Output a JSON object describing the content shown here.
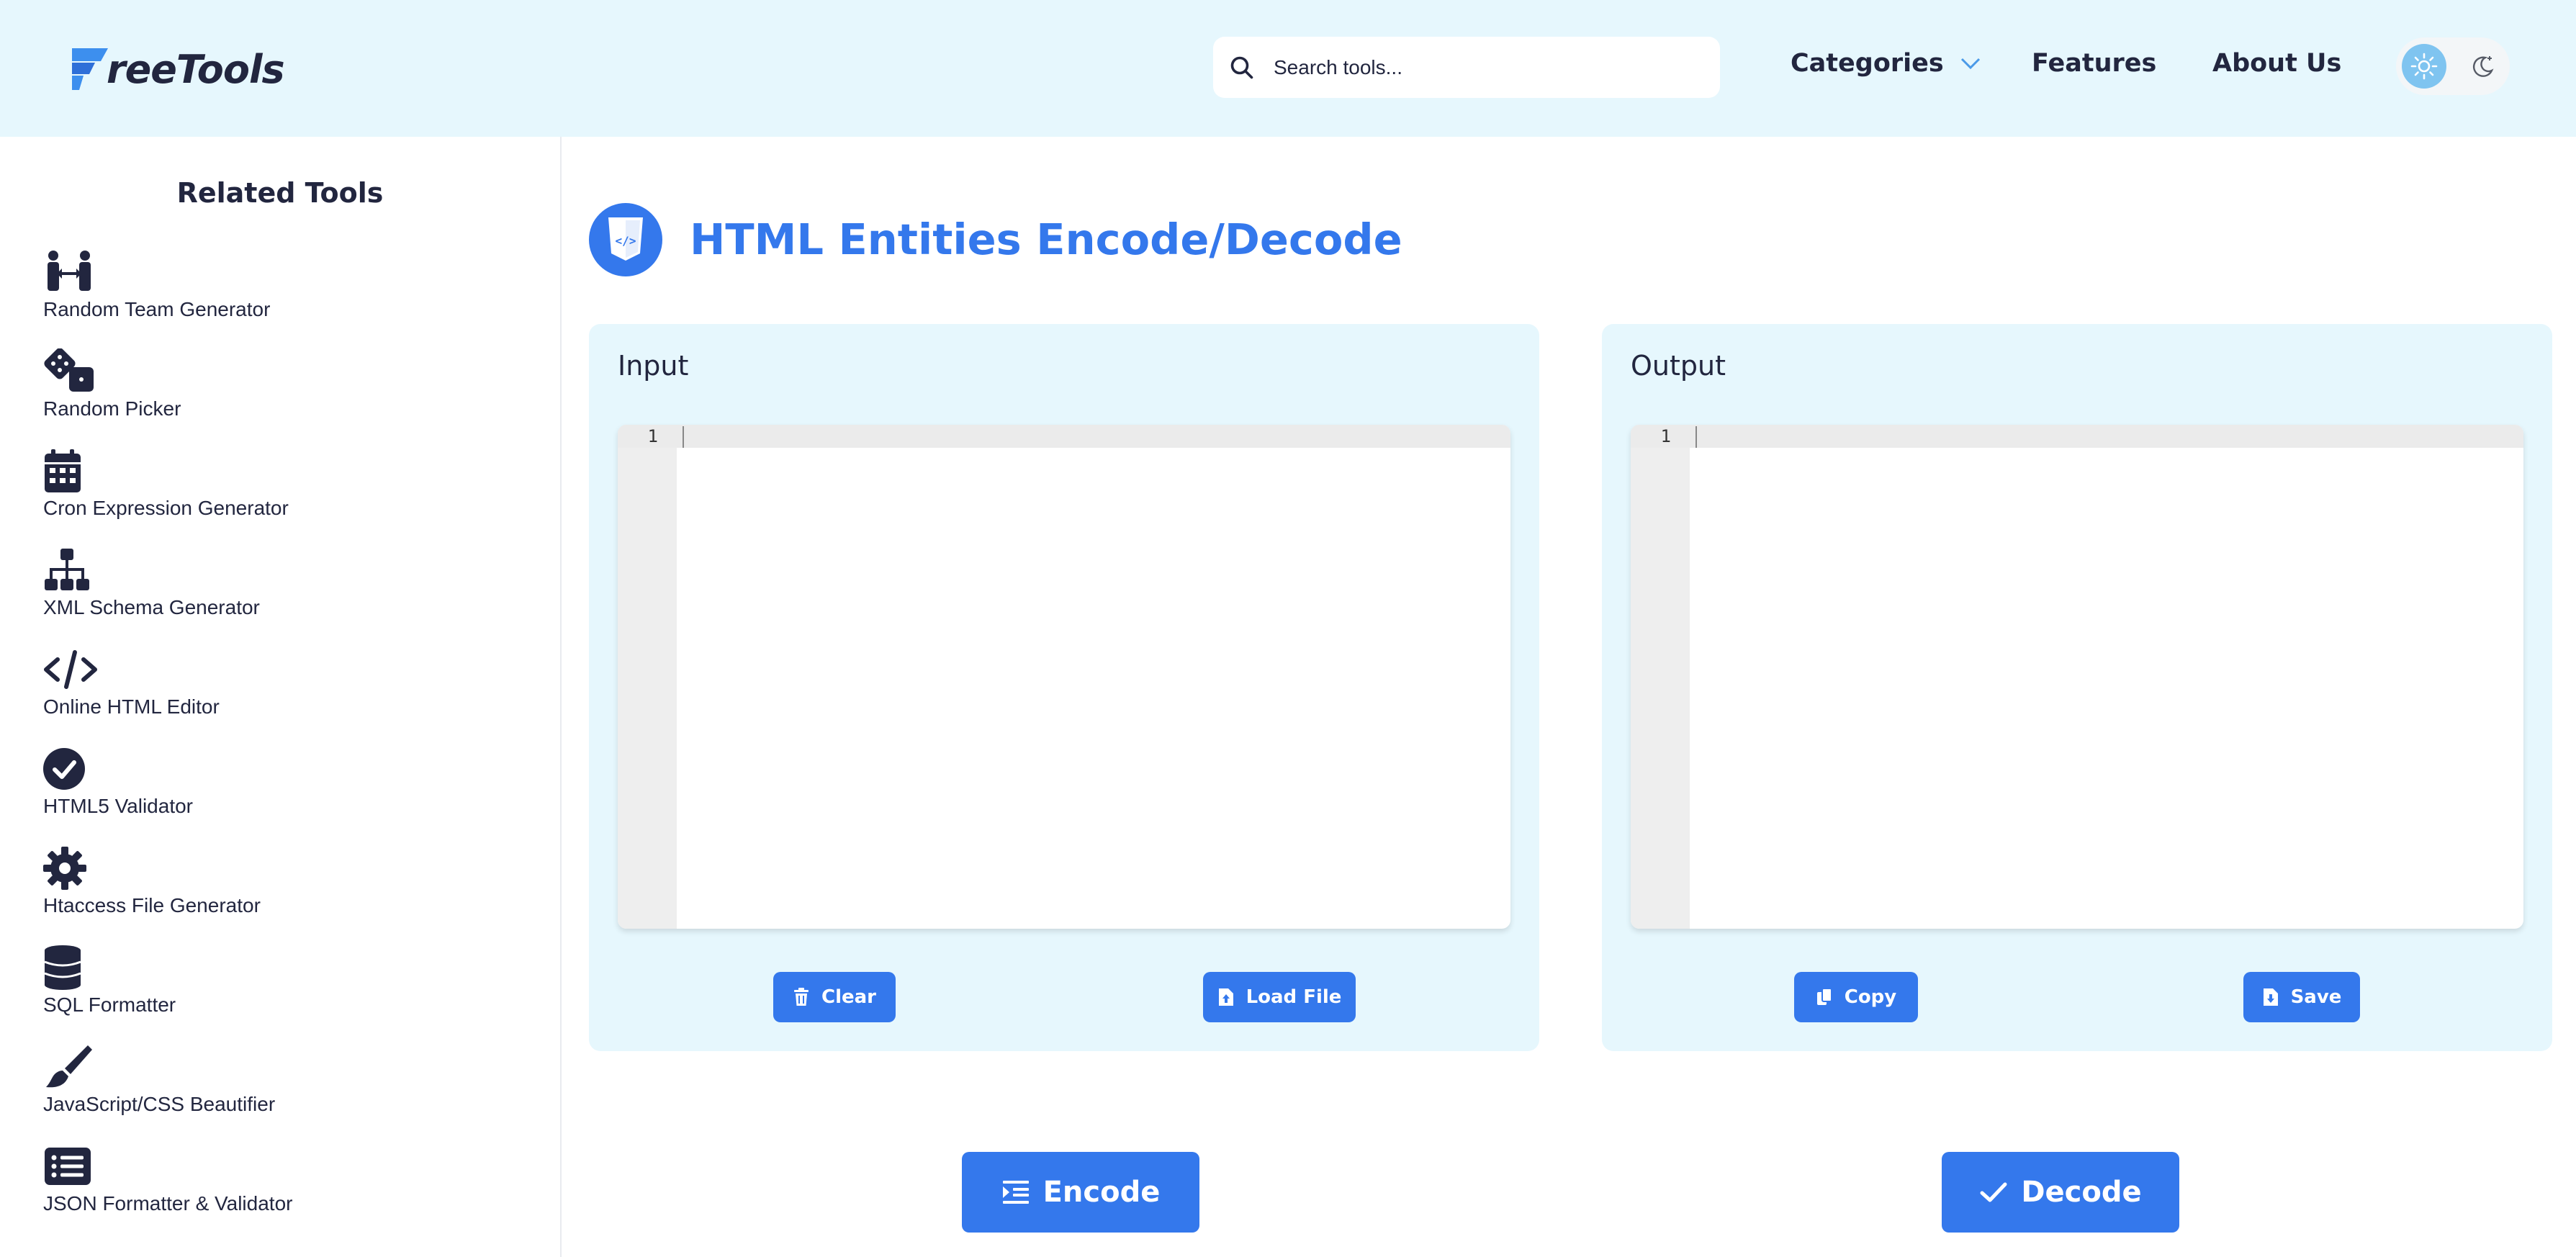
{
  "header": {
    "logo_text": "reeTools",
    "search_placeholder": "Search tools...",
    "nav": {
      "categories": "Categories",
      "features": "Features",
      "about": "About Us"
    }
  },
  "sidebar": {
    "title": "Related Tools",
    "items": [
      {
        "label": "Random Team Generator",
        "icon": "team-icon"
      },
      {
        "label": "Random Picker",
        "icon": "dice-icon"
      },
      {
        "label": "Cron Expression Generator",
        "icon": "calendar-icon"
      },
      {
        "label": "XML Schema Generator",
        "icon": "sitemap-icon"
      },
      {
        "label": "Online HTML Editor",
        "icon": "code-icon"
      },
      {
        "label": "HTML5 Validator",
        "icon": "check-circle-icon"
      },
      {
        "label": "Htaccess File Generator",
        "icon": "gear-icon"
      },
      {
        "label": "SQL Formatter",
        "icon": "database-icon"
      },
      {
        "label": "JavaScript/CSS Beautifier",
        "icon": "brush-icon"
      },
      {
        "label": "JSON Formatter & Validator",
        "icon": "list-icon"
      }
    ]
  },
  "main": {
    "title": "HTML Entities Encode/Decode",
    "input": {
      "label": "Input",
      "line_number": "1",
      "clear_label": "Clear",
      "load_label": "Load File"
    },
    "output": {
      "label": "Output",
      "line_number": "1",
      "copy_label": "Copy",
      "save_label": "Save"
    },
    "encode_label": "Encode",
    "decode_label": "Decode"
  },
  "colors": {
    "accent": "#3478ec",
    "header_bg": "#e6f7fd",
    "panel_bg": "#e6f7fd",
    "text_dark": "#22263f"
  }
}
